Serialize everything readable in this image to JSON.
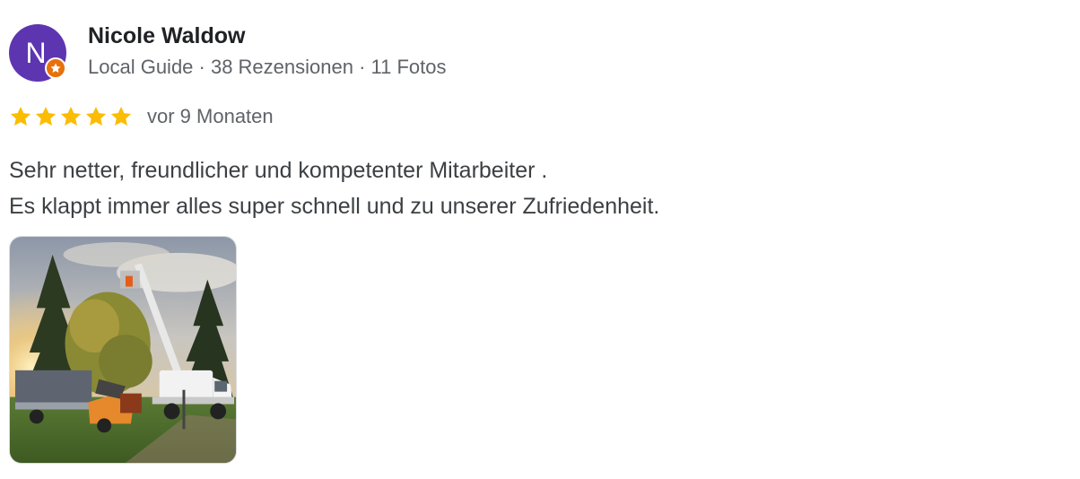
{
  "author": {
    "initial": "N",
    "name": "Nicole Waldow",
    "meta": "Local Guide · 38 Rezensionen · 11 Fotos",
    "avatar_color": "#5e35b1",
    "badge_color": "#e8710a",
    "badge_icon": "local-guide-star-icon"
  },
  "rating": {
    "stars": 5,
    "max": 5,
    "star_color": "#fbbc04",
    "date": "vor 9 Monaten"
  },
  "review": {
    "lines": [
      "Sehr netter, freundlicher und kompetenter Mitarbeiter .",
      "Es klappt immer alles super schnell und zu unserer Zufriedenheit."
    ]
  },
  "photos": {
    "count_shown": 1
  }
}
